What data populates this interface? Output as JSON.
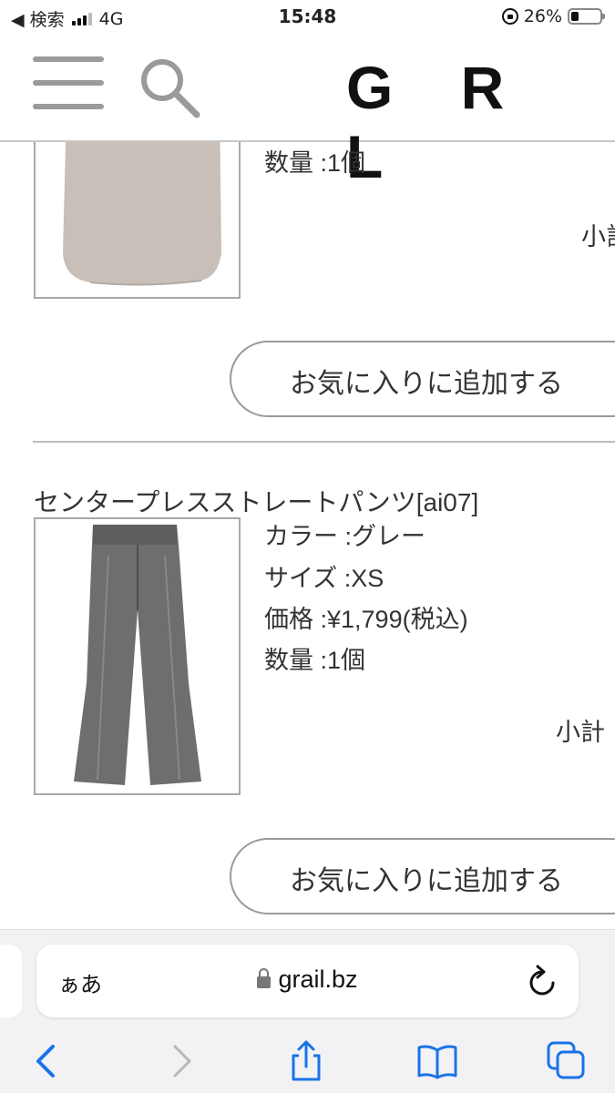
{
  "status_bar": {
    "carrier_back": "◀ 検索",
    "network": "4G",
    "time": "15:48",
    "battery": "26%"
  },
  "header": {
    "logo": "G R L"
  },
  "cart": {
    "item1": {
      "quantity": "数量 :1個",
      "subtotal": "小計",
      "favorite_button": "お気に入りに追加する"
    },
    "item2": {
      "name": "センタープレスストレートパンツ[ai07]",
      "color": "カラー :グレー",
      "size": "サイズ :XS",
      "price": "価格 :¥1,799(税込)",
      "quantity": "数量 :1個",
      "subtotal": "小計",
      "favorite_button": "お気に入りに追加する"
    }
  },
  "browser": {
    "text_size_button": "ぁあ",
    "url": "grail.bz"
  },
  "colors": {
    "icon_blue": "#1a73e8",
    "divider": "#bdbdbd",
    "pants_gray": "#6e6e6e",
    "top_beige": "#c7bfb8"
  }
}
